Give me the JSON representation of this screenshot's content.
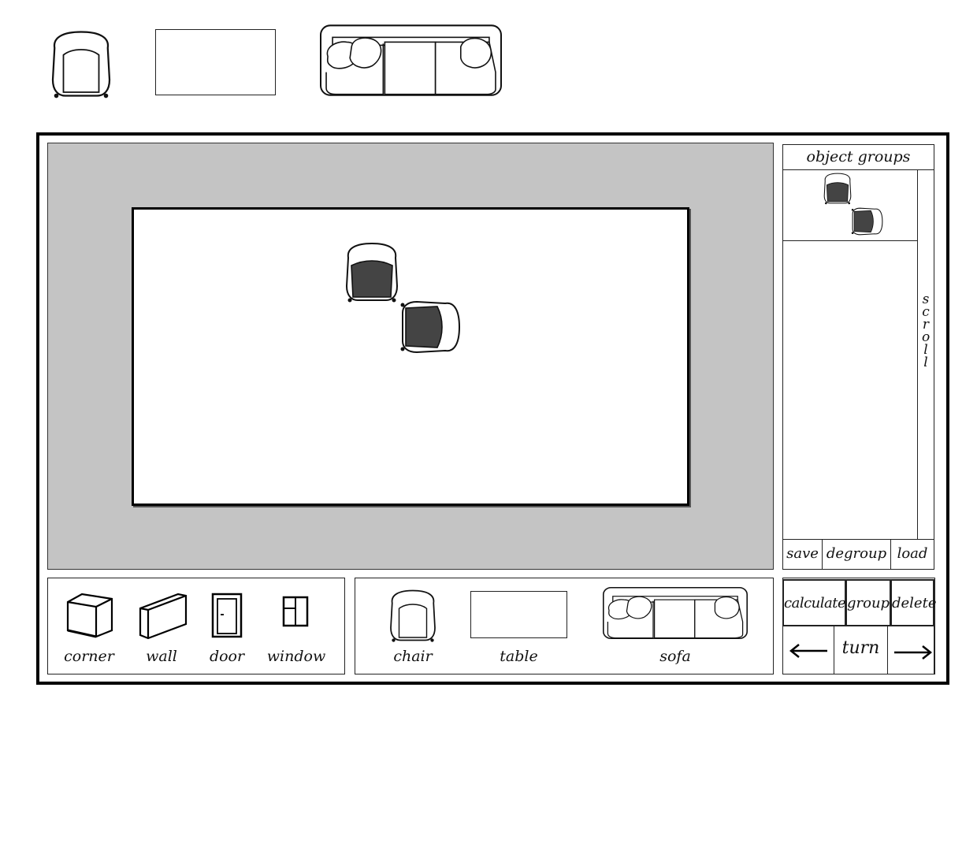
{
  "object_groups": {
    "title": "object groups",
    "scroll_label": "scroll",
    "footer": {
      "save": "save",
      "degroup": "degroup",
      "load": "load"
    }
  },
  "structure_palette": {
    "items": [
      {
        "label": "corner",
        "icon": "corner-icon"
      },
      {
        "label": "wall",
        "icon": "wall-icon"
      },
      {
        "label": "door",
        "icon": "door-icon"
      },
      {
        "label": "window",
        "icon": "window-icon"
      }
    ]
  },
  "furniture_palette": {
    "items": [
      {
        "label": "chair",
        "icon": "chair-icon"
      },
      {
        "label": "table",
        "icon": "table-icon"
      },
      {
        "label": "sofa",
        "icon": "sofa-icon"
      }
    ]
  },
  "actions": {
    "calculate": "calculate",
    "group": "group",
    "delete": "delete",
    "turn": "turn",
    "turn_left_icon": "arrow-left-icon",
    "turn_right_icon": "arrow-right-icon"
  },
  "colors": {
    "canvas_background": "#c4c4c4",
    "room_floor": "#ffffff",
    "selected_fill": "#444444"
  }
}
